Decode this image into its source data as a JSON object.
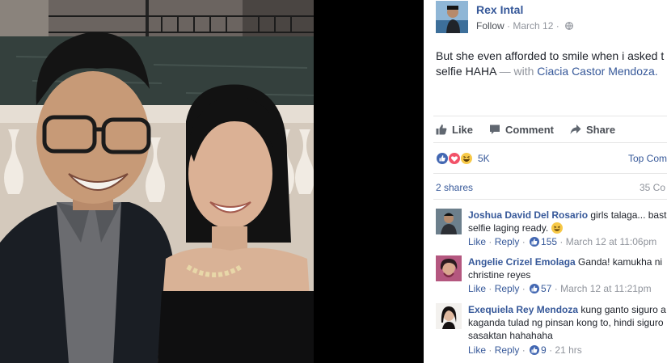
{
  "post": {
    "author": "Rex Intal",
    "follow_label": "Follow",
    "date": "March 12",
    "text_main": "But she even afforded to smile when i asked t",
    "text_line2": "selfie HAHA",
    "with_label": "— with",
    "tagged": "Ciacia Castor Mendoza."
  },
  "actions": {
    "like": "Like",
    "comment": "Comment",
    "share": "Share"
  },
  "reactions": {
    "icons": [
      "like-icon",
      "love-icon",
      "haha-icon"
    ],
    "count": "5K",
    "top_comments": "Top Comm"
  },
  "shares": {
    "label": "2 shares",
    "right_count": "35 Co"
  },
  "comments": [
    {
      "author": "Joshua David Del Rosario",
      "text": " girls talaga... bast selfie laging ready.",
      "like": "Like",
      "reply": "Reply",
      "likes": "155",
      "time": "March 12 at 11:06pm"
    },
    {
      "author": "Angelie Crizel Emolaga",
      "text": " Ganda! kamukha ni christine reyes",
      "like": "Like",
      "reply": "Reply",
      "likes": "57",
      "time": "March 12 at 11:21pm"
    },
    {
      "author": "Exequiela Rey Mendoza",
      "text": " kung ganto siguro a kaganda tulad ng pinsan kong to, hindi siguro sasaktan hahahaha",
      "like": "Like",
      "reply": "Reply",
      "likes": "9",
      "time": "21 hrs"
    }
  ],
  "colors": {
    "link": "#365899",
    "meta": "#90949c",
    "like_blue": "#4267b2",
    "love_red": "#f25268",
    "haha_yellow": "#f7c948"
  }
}
